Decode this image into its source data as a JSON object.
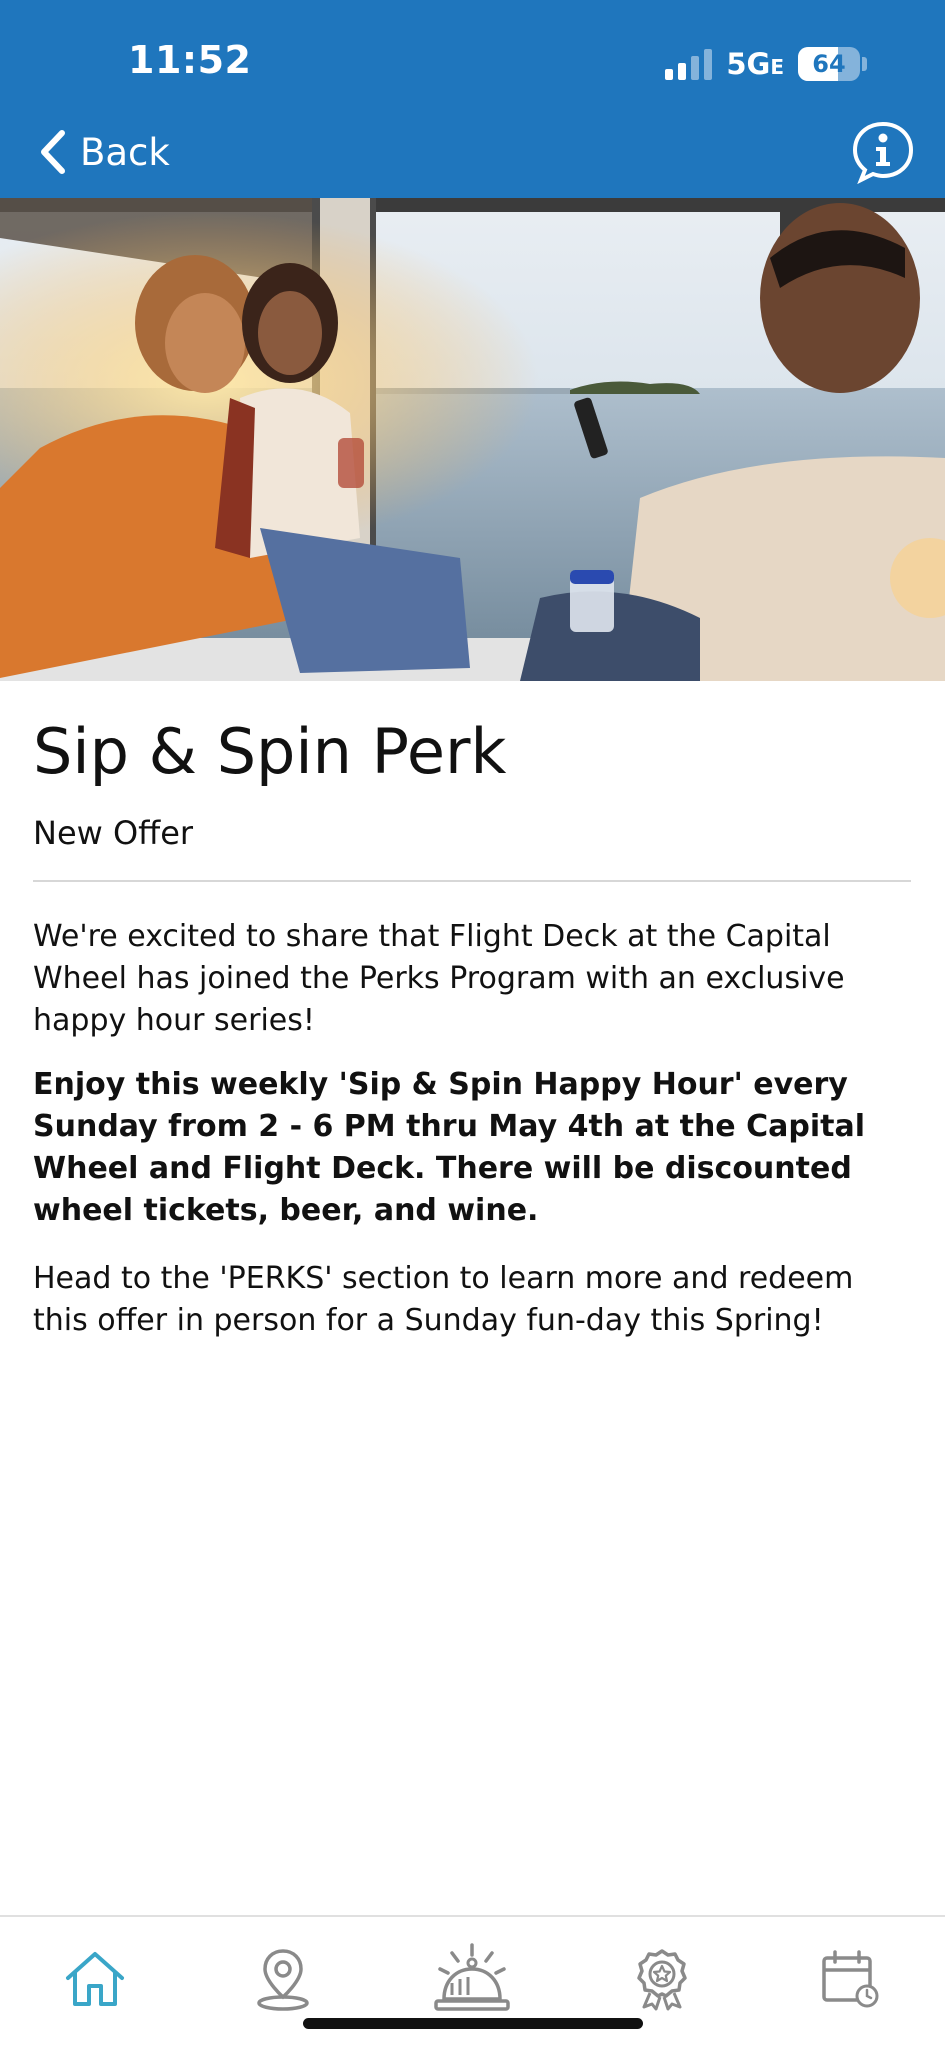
{
  "status_bar": {
    "time": "11:52",
    "network": "5G",
    "network_suffix": "E",
    "battery": "64"
  },
  "nav": {
    "back_label": "Back",
    "back_icon": "chevron-left-icon",
    "info_icon": "info-icon"
  },
  "article": {
    "title": "Sip & Spin Perk",
    "subtitle": "New Offer",
    "paragraph1": "We're excited to share that Flight Deck at the Capital Wheel has joined the Perks Program with an exclusive happy hour series!",
    "paragraph_bold": "Enjoy this weekly 'Sip & Spin Happy Hour' every Sunday from 2 - 6 PM thru May 4th at the Capital Wheel and Flight Deck. There will be discounted wheel tickets, beer, and wine.",
    "paragraph2": "Head to the 'PERKS' section to learn more and redeem this offer in person for a Sunday fun-day this Spring!"
  },
  "tabbar": {
    "tabs": [
      {
        "icon": "home-icon",
        "active": true
      },
      {
        "icon": "map-pin-icon",
        "active": false
      },
      {
        "icon": "service-bell-icon",
        "active": false
      },
      {
        "icon": "award-badge-icon",
        "active": false
      },
      {
        "icon": "calendar-icon",
        "active": false
      }
    ]
  },
  "colors": {
    "header_bg": "#1f76bd",
    "active_tab": "#3aa6c8",
    "inactive_tab": "#8a8a8a"
  }
}
